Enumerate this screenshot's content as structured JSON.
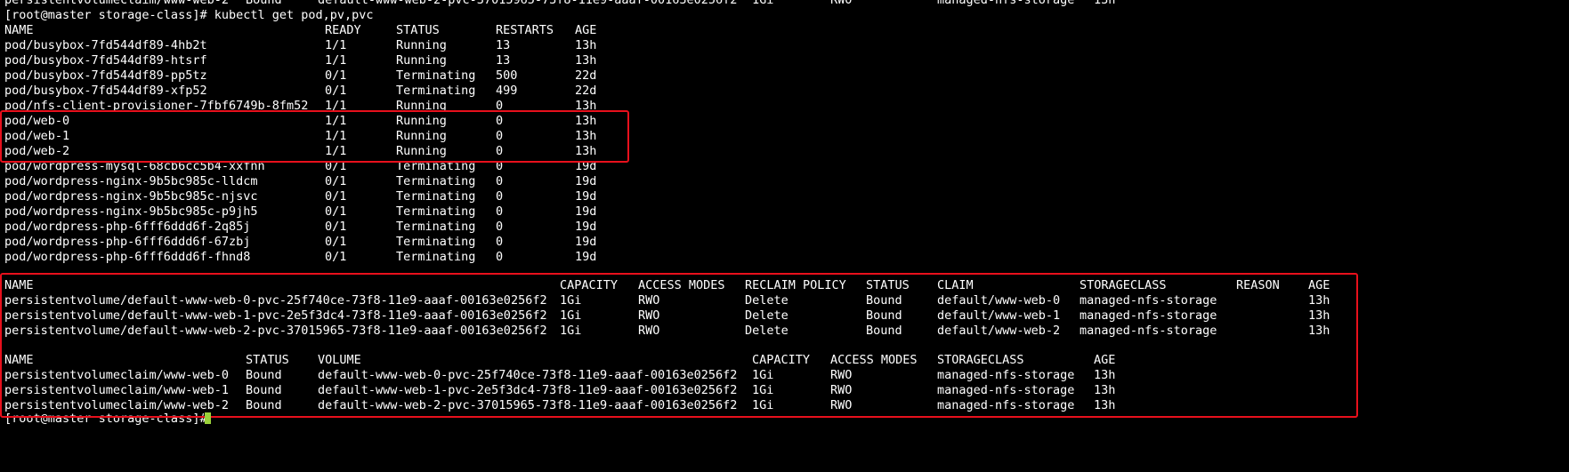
{
  "terminal": {
    "partial_top_line": [
      "persistentvolumeclaim/www-web-2",
      "Bound",
      "default-www-web-2-pvc-37015965-73f8-11e9-aaaf-00163e0256f2",
      "1Gi",
      "RWO",
      "managed-nfs-storage",
      "13h"
    ],
    "prompt": "[root@master storage-class]# kubectl get pod,pv,pvc",
    "pods": {
      "headers": [
        "NAME",
        "READY",
        "STATUS",
        "RESTARTS",
        "AGE"
      ],
      "rows": [
        [
          "pod/busybox-7fd544df89-4hb2t",
          "1/1",
          "Running",
          "13",
          "13h"
        ],
        [
          "pod/busybox-7fd544df89-htsrf",
          "1/1",
          "Running",
          "13",
          "13h"
        ],
        [
          "pod/busybox-7fd544df89-pp5tz",
          "0/1",
          "Terminating",
          "500",
          "22d"
        ],
        [
          "pod/busybox-7fd544df89-xfp52",
          "0/1",
          "Terminating",
          "499",
          "22d"
        ],
        [
          "pod/nfs-client-provisioner-7fbf6749b-8fm52",
          "1/1",
          "Running",
          "0",
          "13h"
        ],
        [
          "pod/web-0",
          "1/1",
          "Running",
          "0",
          "13h"
        ],
        [
          "pod/web-1",
          "1/1",
          "Running",
          "0",
          "13h"
        ],
        [
          "pod/web-2",
          "1/1",
          "Running",
          "0",
          "13h"
        ],
        [
          "pod/wordpress-mysql-68cb6cc5b4-xxfnn",
          "0/1",
          "Terminating",
          "0",
          "19d"
        ],
        [
          "pod/wordpress-nginx-9b5bc985c-lldcm",
          "0/1",
          "Terminating",
          "0",
          "19d"
        ],
        [
          "pod/wordpress-nginx-9b5bc985c-njsvc",
          "0/1",
          "Terminating",
          "0",
          "19d"
        ],
        [
          "pod/wordpress-nginx-9b5bc985c-p9jh5",
          "0/1",
          "Terminating",
          "0",
          "19d"
        ],
        [
          "pod/wordpress-php-6fff6ddd6f-2q85j",
          "0/1",
          "Terminating",
          "0",
          "19d"
        ],
        [
          "pod/wordpress-php-6fff6ddd6f-67zbj",
          "0/1",
          "Terminating",
          "0",
          "19d"
        ],
        [
          "pod/wordpress-php-6fff6ddd6f-fhnd8",
          "0/1",
          "Terminating",
          "0",
          "19d"
        ]
      ]
    },
    "pvs": {
      "headers": [
        "NAME",
        "CAPACITY",
        "ACCESS MODES",
        "RECLAIM POLICY",
        "STATUS",
        "CLAIM",
        "STORAGECLASS",
        "REASON",
        "AGE"
      ],
      "rows": [
        [
          "persistentvolume/default-www-web-0-pvc-25f740ce-73f8-11e9-aaaf-00163e0256f2",
          "1Gi",
          "RWO",
          "Delete",
          "Bound",
          "default/www-web-0",
          "managed-nfs-storage",
          "",
          "13h"
        ],
        [
          "persistentvolume/default-www-web-1-pvc-2e5f3dc4-73f8-11e9-aaaf-00163e0256f2",
          "1Gi",
          "RWO",
          "Delete",
          "Bound",
          "default/www-web-1",
          "managed-nfs-storage",
          "",
          "13h"
        ],
        [
          "persistentvolume/default-www-web-2-pvc-37015965-73f8-11e9-aaaf-00163e0256f2",
          "1Gi",
          "RWO",
          "Delete",
          "Bound",
          "default/www-web-2",
          "managed-nfs-storage",
          "",
          "13h"
        ]
      ]
    },
    "pvcs": {
      "headers": [
        "NAME",
        "STATUS",
        "VOLUME",
        "CAPACITY",
        "ACCESS MODES",
        "STORAGECLASS",
        "AGE"
      ],
      "rows": [
        [
          "persistentvolumeclaim/www-web-0",
          "Bound",
          "default-www-web-0-pvc-25f740ce-73f8-11e9-aaaf-00163e0256f2",
          "1Gi",
          "RWO",
          "managed-nfs-storage",
          "13h"
        ],
        [
          "persistentvolumeclaim/www-web-1",
          "Bound",
          "default-www-web-1-pvc-2e5f3dc4-73f8-11e9-aaaf-00163e0256f2",
          "1Gi",
          "RWO",
          "managed-nfs-storage",
          "13h"
        ],
        [
          "persistentvolumeclaim/www-web-2",
          "Bound",
          "default-www-web-2-pvc-37015965-73f8-11e9-aaaf-00163e0256f2",
          "1Gi",
          "RWO",
          "managed-nfs-storage",
          "13h"
        ]
      ]
    },
    "partial_bottom_line": "[root@master storage-class]#",
    "colors": {
      "background": "#000000",
      "text": "#ffffff",
      "highlight_border": "#e8101c",
      "cursor": "#9bd23a"
    }
  }
}
